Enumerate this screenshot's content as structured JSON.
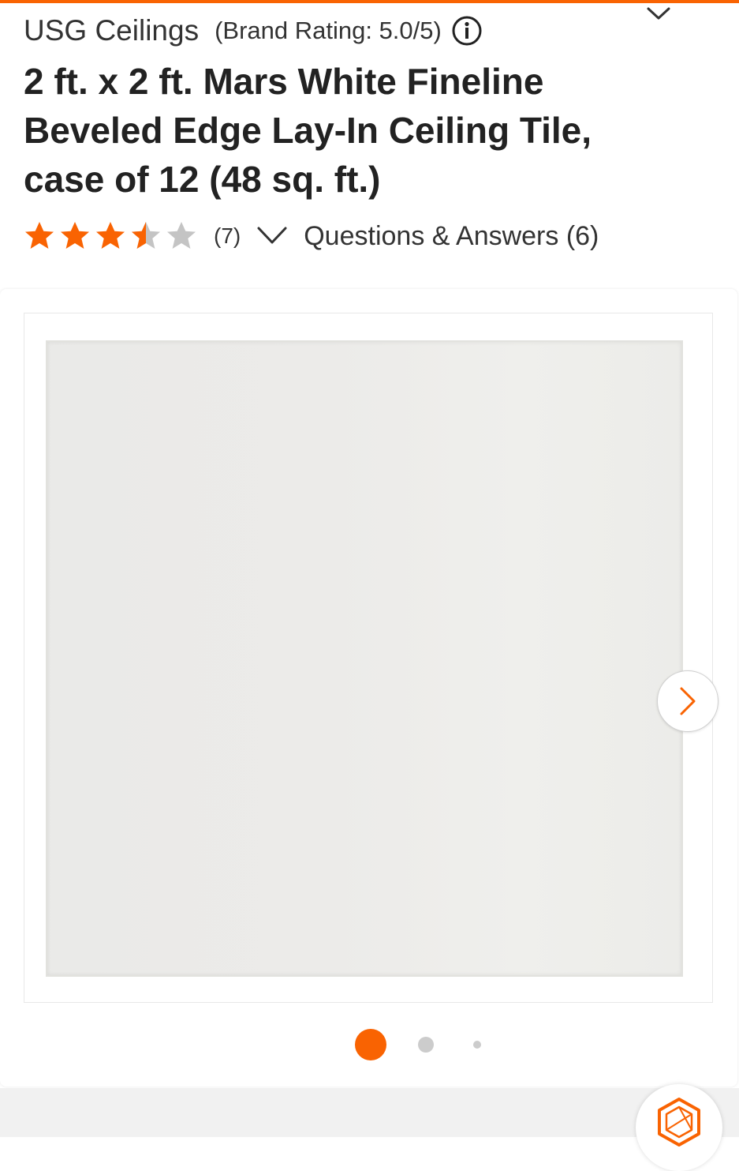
{
  "header": {
    "brand_name": "USG Ceilings",
    "brand_rating": "(Brand Rating: 5.0/5)",
    "collapse_icon": "chevron-down-icon",
    "info_icon": "info-icon"
  },
  "product": {
    "title": "2 ft. x 2 ft. Mars White Fineline Beveled Edge Lay-In Ceiling Tile, case of 12 (48 sq. ft.)",
    "rating_stars": 3.5,
    "rating_max": 5,
    "review_count": "(7)",
    "qa_link": "Questions & Answers (6)"
  },
  "gallery": {
    "image_alt": "ceiling tile product image",
    "total_images": 3,
    "current_index": 1,
    "next_icon": "chevron-right-icon"
  },
  "colors": {
    "accent": "#f96302",
    "star_filled": "#f96302",
    "star_empty": "#c4c4c4",
    "text": "#333333"
  },
  "assistant": {
    "icon": "assistant-hexagon-icon"
  }
}
